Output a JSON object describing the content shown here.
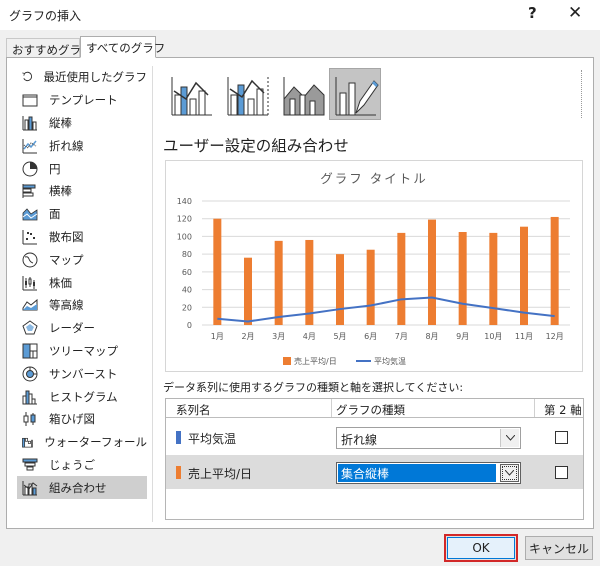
{
  "window": {
    "title": "グラフの挿入",
    "help": "?",
    "close": "✕"
  },
  "tabs": [
    "おすすめグラフ",
    "すべてのグラフ"
  ],
  "sidebar": [
    {
      "label": "最近使用したグラフ",
      "icon": "recent-icon"
    },
    {
      "label": "テンプレート",
      "icon": "folder-icon"
    },
    {
      "label": "縦棒",
      "icon": "column-chart-icon"
    },
    {
      "label": "折れ線",
      "icon": "line-chart-icon"
    },
    {
      "label": "円",
      "icon": "pie-chart-icon"
    },
    {
      "label": "横棒",
      "icon": "bar-chart-icon"
    },
    {
      "label": "面",
      "icon": "area-chart-icon"
    },
    {
      "label": "散布図",
      "icon": "scatter-chart-icon"
    },
    {
      "label": "マップ",
      "icon": "map-chart-icon"
    },
    {
      "label": "株価",
      "icon": "stock-chart-icon"
    },
    {
      "label": "等高線",
      "icon": "surface-chart-icon"
    },
    {
      "label": "レーダー",
      "icon": "radar-chart-icon"
    },
    {
      "label": "ツリーマップ",
      "icon": "treemap-icon"
    },
    {
      "label": "サンバースト",
      "icon": "sunburst-icon"
    },
    {
      "label": "ヒストグラム",
      "icon": "histogram-icon"
    },
    {
      "label": "箱ひげ図",
      "icon": "box-whisker-icon"
    },
    {
      "label": "ウォーターフォール",
      "icon": "waterfall-icon"
    },
    {
      "label": "じょうご",
      "icon": "funnel-icon"
    },
    {
      "label": "組み合わせ",
      "icon": "combo-chart-icon"
    }
  ],
  "selected_category": "組み合わせ",
  "section_title": "ユーザー設定の組み合わせ",
  "chart_data": {
    "type": "bar",
    "title": "グラフ タイトル",
    "categories": [
      "1月",
      "2月",
      "3月",
      "4月",
      "5月",
      "6月",
      "7月",
      "8月",
      "9月",
      "10月",
      "11月",
      "12月"
    ],
    "series": [
      {
        "name": "売上平均/日",
        "type": "bar",
        "color": "#ed7d31",
        "values": [
          120,
          76,
          95,
          96,
          80,
          85,
          104,
          119,
          105,
          104,
          111,
          122
        ]
      },
      {
        "name": "平均気温",
        "type": "line",
        "color": "#4472c4",
        "values": [
          7,
          4,
          9,
          13,
          18,
          22,
          29,
          31,
          24,
          19,
          14,
          10
        ]
      }
    ],
    "ylim": [
      0,
      140
    ],
    "yticks": [
      0,
      20,
      40,
      60,
      80,
      100,
      120,
      140
    ],
    "grid": true,
    "legend_position": "bottom"
  },
  "series_section": {
    "caption": "データ系列に使用するグラフの種類と軸を選択してください:",
    "headers": {
      "name": "系列名",
      "type": "グラフの種類",
      "axis": "第 2 軸"
    },
    "rows": [
      {
        "name": "平均気温",
        "color": "#4472c4",
        "type": "折れ線",
        "secondary": false
      },
      {
        "name": "売上平均/日",
        "color": "#ed7d31",
        "type": "集合縦棒",
        "secondary": false
      }
    ]
  },
  "buttons": {
    "ok": "OK",
    "cancel": "キャンセル"
  }
}
